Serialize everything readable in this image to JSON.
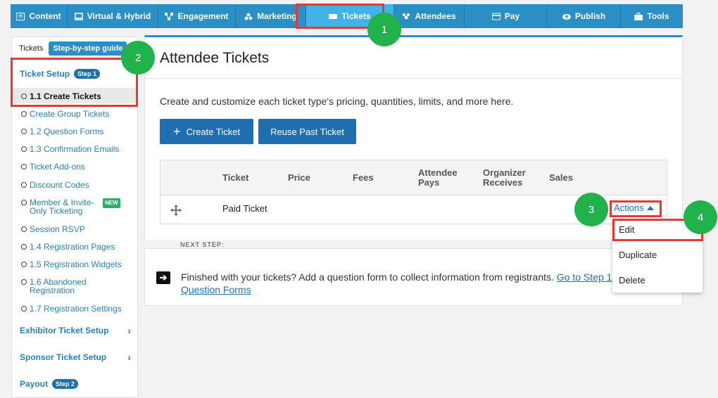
{
  "nav": [
    {
      "label": "Content",
      "icon": "content-icon"
    },
    {
      "label": "Virtual & Hybrid",
      "icon": "monitor-icon"
    },
    {
      "label": "Engagement",
      "icon": "network-icon"
    },
    {
      "label": "Marketing",
      "icon": "marketing-icon"
    },
    {
      "label": "Tickets",
      "icon": "ticket-icon",
      "active": true
    },
    {
      "label": "Attendees",
      "icon": "attendees-icon"
    },
    {
      "label": "Pay",
      "icon": "card-icon"
    },
    {
      "label": "Publish",
      "icon": "cloud-upload-icon"
    },
    {
      "label": "Tools",
      "icon": "toolbox-icon"
    }
  ],
  "sidebar": {
    "tab_tickets": "Tickets",
    "tab_guide": "Step-by-step guide",
    "ticket_setup": "Ticket Setup",
    "step1": "Step 1",
    "items": [
      "1.1 Create Tickets",
      "Create Group Tickets",
      "1.2 Question Forms",
      "1.3 Confirmation Emails",
      "Ticket Add-ons",
      "Discount Codes",
      "Member & Invite-Only Ticketing",
      "Session RSVP",
      "1.4 Registration Pages",
      "1.5 Registration Widgets",
      "1.6 Abandoned Registration",
      "1.7 Registration Settings"
    ],
    "new_badge": "NEW",
    "exhibitor": "Exhibitor Ticket Setup",
    "sponsor": "Sponsor Ticket Setup",
    "payout": "Payout",
    "step2": "Step 2"
  },
  "main": {
    "title": "Attendee Tickets",
    "description": "Create and customize each ticket type's pricing, quantities, limits, and more here.",
    "create_btn": "Create Ticket",
    "reuse_btn": "Reuse Past Ticket",
    "headers": [
      "Ticket",
      "Price",
      "Fees",
      "Attendee Pays",
      "Organizer Receives",
      "Sales"
    ],
    "row_ticket": "Paid Ticket",
    "actions": "Actions"
  },
  "dropdown": [
    "Edit",
    "Duplicate",
    "Delete"
  ],
  "next_step": {
    "label": "NEXT STEP:",
    "text": "Finished with your tickets? Add a question form to collect information from registrants.",
    "link": "Go to Step 1.2: Question Forms"
  },
  "markers": [
    "1",
    "2",
    "3",
    "4"
  ],
  "colors": {
    "nav": "#2a8fc4",
    "nav_active": "#40b3e8",
    "button": "#1f6fb0",
    "highlight": "#e53935",
    "marker": "#22b24c"
  }
}
